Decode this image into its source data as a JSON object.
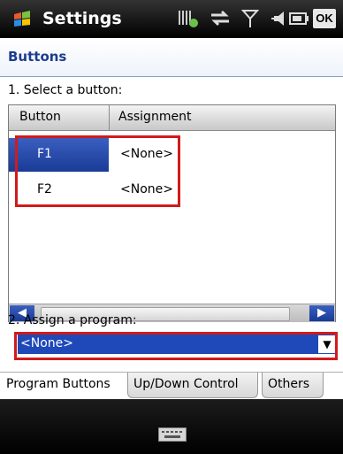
{
  "titlebar": {
    "title": "Settings",
    "ok_label": "OK",
    "icons": [
      "windows-flag-icon",
      "battery-charging-icon",
      "network-sync-icon",
      "signal-antenna-icon",
      "speaker-icon",
      "battery-icon"
    ]
  },
  "page": {
    "header": "Buttons",
    "step1_label": "1. Select a button:",
    "step2_label": "2. Assign a program:"
  },
  "listview": {
    "columns": [
      "Button",
      "Assignment"
    ],
    "rows": [
      {
        "button": "F1",
        "assignment": "<None>",
        "selected": true
      },
      {
        "button": "F2",
        "assignment": "<None>",
        "selected": false
      }
    ]
  },
  "dropdown": {
    "value": "<None>"
  },
  "tabs": [
    {
      "label": "Program Buttons",
      "active": true
    },
    {
      "label": "Up/Down Control",
      "active": false
    },
    {
      "label": "Others",
      "active": false
    }
  ],
  "colors": {
    "header_text": "#1d3c8f",
    "selection": "#1f49b8",
    "highlight": "#d21a1a"
  }
}
